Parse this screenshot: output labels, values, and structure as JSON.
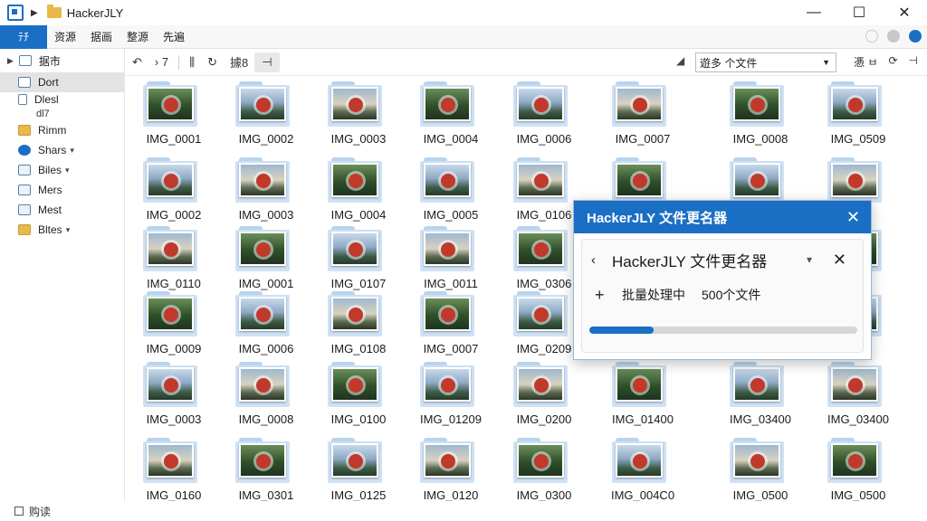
{
  "window": {
    "title": "HackerJLY",
    "minimize": "—",
    "maximize": "☐",
    "close": "✕"
  },
  "ribbon": {
    "file_tab": "ﾃﾁ",
    "tabs": [
      "资源",
      "据画",
      "整源",
      "先遍"
    ]
  },
  "sidebar": {
    "quick_access": "据市",
    "items": [
      {
        "label": "Dort",
        "icon": "document-icon",
        "selected": true
      },
      {
        "label": "Dlesl",
        "icon": "document-icon"
      },
      {
        "label": "dl7",
        "icon": "none"
      },
      {
        "label": "Rimm",
        "icon": "folder-icon"
      },
      {
        "label": "Shars",
        "icon": "network-icon",
        "caret": "▾"
      },
      {
        "label": "Biles",
        "icon": "drive-icon",
        "caret": "▾"
      },
      {
        "label": "Mers",
        "icon": "pictures-icon"
      },
      {
        "label": "Mest",
        "icon": "documents-icon"
      },
      {
        "label": "Bltes",
        "icon": "drive-icon",
        "caret": "▾"
      }
    ]
  },
  "toolbar": {
    "undo": "↶",
    "nav": "› 7",
    "sep1": "⫼",
    "refresh": "↻",
    "view": "據8",
    "pin": "⊣",
    "sort_label": "遊多 个文件",
    "right_a": "慿 ㅂ",
    "right_b": "⟳",
    "right_c": "⊣"
  },
  "files": [
    [
      "IMG_0001",
      "IMG_0002",
      "IMG_0003",
      "IMG_0004",
      "IMG_0006",
      "IMG_0007",
      "IMG_0008",
      "IMG_0509"
    ],
    [
      "IMG_0002",
      "IMG_0003",
      "IMG_0004",
      "IMG_0005",
      "IMG_0106",
      "",
      "",
      "00"
    ],
    [
      "IMG_0110",
      "IMG_0001",
      "IMG_0107",
      "IMG_0011",
      "IMG_0306",
      "",
      "",
      "00"
    ],
    [
      "IMG_0009",
      "IMG_0006",
      "IMG_0108",
      "IMG_0007",
      "IMG_0209",
      "",
      "",
      "000"
    ],
    [
      "IMG_0003",
      "IMG_0008",
      "IMG_0100",
      "IMG_01209",
      "IMG_0200",
      "IMG_01400",
      "IMG_03400",
      "IMG_03400"
    ],
    [
      "IMG_0160",
      "IMG_0301",
      "IMG_0125",
      "IMG_0120",
      "IMG_0300",
      "IMG_004C0",
      "IMG_0500",
      "IMG_0500"
    ]
  ],
  "status": {
    "text": "购读"
  },
  "dialog": {
    "title": "HackerJLY 文件更名器",
    "close": "✕",
    "back": "‹",
    "subtitle": "HackerJLY 文件更名器",
    "pin": "▾",
    "x": "✕",
    "plus": "+",
    "status_text": "批量处理中",
    "count_text": "500个文件",
    "progress": 0.24
  },
  "colors": {
    "accent": "#1a6fc4",
    "folder": "#cfe2f5",
    "badge": "#c0392b"
  }
}
